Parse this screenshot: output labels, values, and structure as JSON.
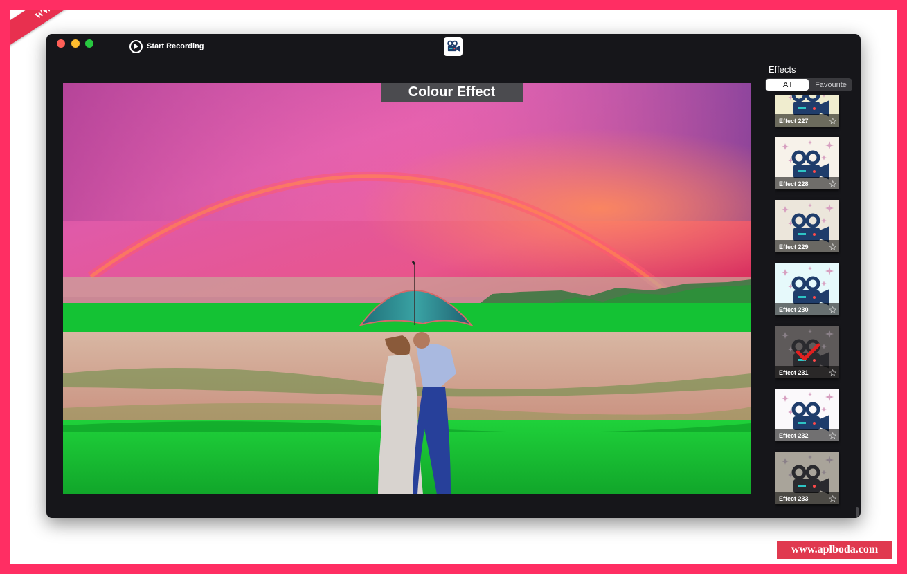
{
  "watermark": {
    "corner_text": "www.aplboda.com",
    "badge_text": "www.aplboda.com"
  },
  "toolbar": {
    "record_label": "Start Recording",
    "app_icon": "movie-camera-icon"
  },
  "preview": {
    "effect_title": "Colour Effect"
  },
  "sidebar": {
    "title": "Effects",
    "filters": {
      "all": "All",
      "favourite": "Favourite",
      "selected": "All"
    },
    "effects": [
      {
        "label": "Effect 227",
        "bg": "#f0edcf",
        "favourite": false,
        "selected": false
      },
      {
        "label": "Effect 228",
        "bg": "#f7f2ea",
        "favourite": false,
        "selected": false
      },
      {
        "label": "Effect 229",
        "bg": "#ece6db",
        "favourite": false,
        "selected": false
      },
      {
        "label": "Effect 230",
        "bg": "#e6f9fb",
        "favourite": false,
        "selected": false
      },
      {
        "label": "Effect 231",
        "bg": "#5e5a5a",
        "favourite": false,
        "selected": true
      },
      {
        "label": "Effect 232",
        "bg": "#fbf9fb",
        "favourite": false,
        "selected": false
      },
      {
        "label": "Effect 233",
        "bg": "#a9a49a",
        "favourite": false,
        "selected": false
      }
    ]
  },
  "colors": {
    "accent": "#ff2e63",
    "window_bg": "#16161a",
    "selected_check": "#e02020"
  }
}
